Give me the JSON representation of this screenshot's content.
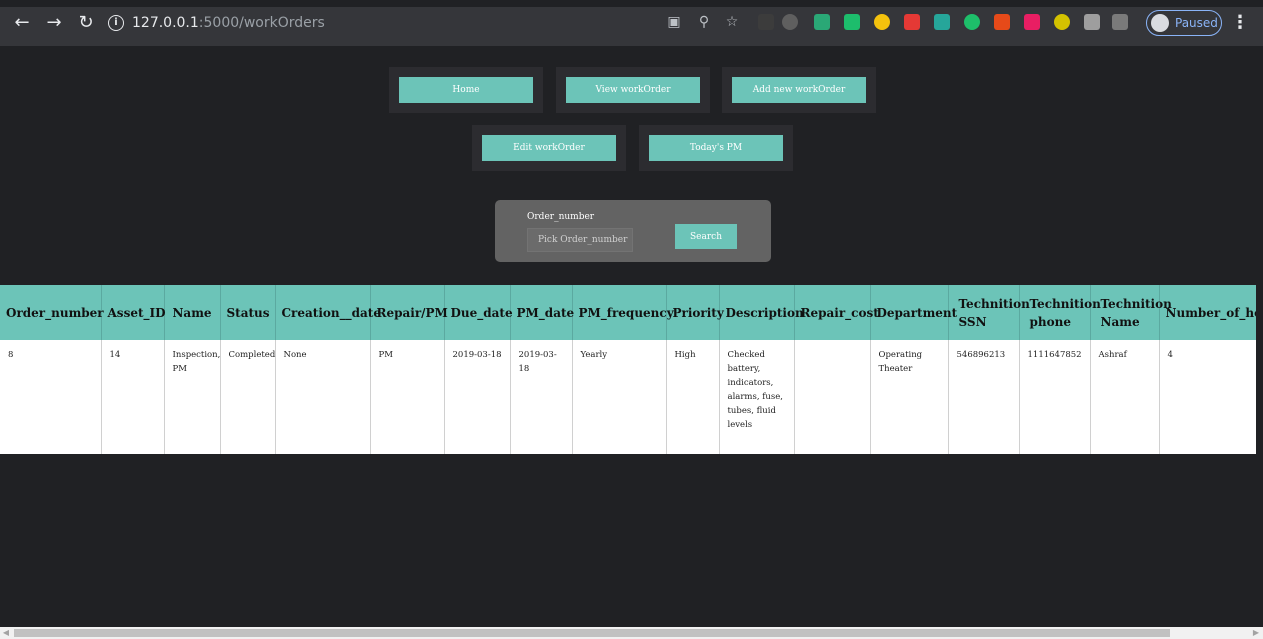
{
  "browser": {
    "url_host": "127.0.0.1",
    "url_rest": ":5000/workOrders",
    "profile_label": "Paused",
    "info_glyph": "i",
    "back_icon": "back-arrow-icon",
    "forward_icon": "forward-arrow-icon",
    "reload_icon": "reload-icon",
    "extension_colors": [
      "#3c3c3c",
      "#5f5f5f",
      "#2aa876",
      "#1dbd6c",
      "#f4c20d",
      "#e53935",
      "#26a69a",
      "#1ebf6a",
      "#e64a19",
      "#e91e63",
      "#d4c200",
      "#9e9e9e",
      "#7a7a7a"
    ]
  },
  "nav": {
    "home": "Home",
    "view": "View workOrder",
    "add": "Add new workOrder",
    "edit": "Edit workOrder",
    "today": "Today's PM"
  },
  "search": {
    "label": "Order_number",
    "placeholder": "Pick Order_number",
    "button": "Search"
  },
  "table": {
    "headers": [
      "Order_number",
      "Asset_ID",
      "Name",
      "Status",
      "Creation__date",
      "Repair/PM",
      "Due_date",
      "PM_date",
      "PM_frequency",
      "Priority",
      "Description",
      "Repair_cost",
      "Department",
      "Technition SSN",
      "Technition phone",
      "Technition Name",
      "Number_of_hours"
    ],
    "rows": [
      [
        "8",
        "14",
        "Inspection, PM",
        "Completed",
        "None",
        "PM",
        "2019-03-18",
        "2019-03-18",
        "Yearly",
        "High",
        "Checked battery, indicators, alarms, fuse, tubes, fluid levels",
        "",
        "Operating Theater",
        "546896213",
        "1111647852",
        "Ashraf",
        "4"
      ]
    ]
  },
  "colors": {
    "accent": "#6cc4b8",
    "page_bg": "#202124",
    "card_bg": "#2c2c30"
  }
}
